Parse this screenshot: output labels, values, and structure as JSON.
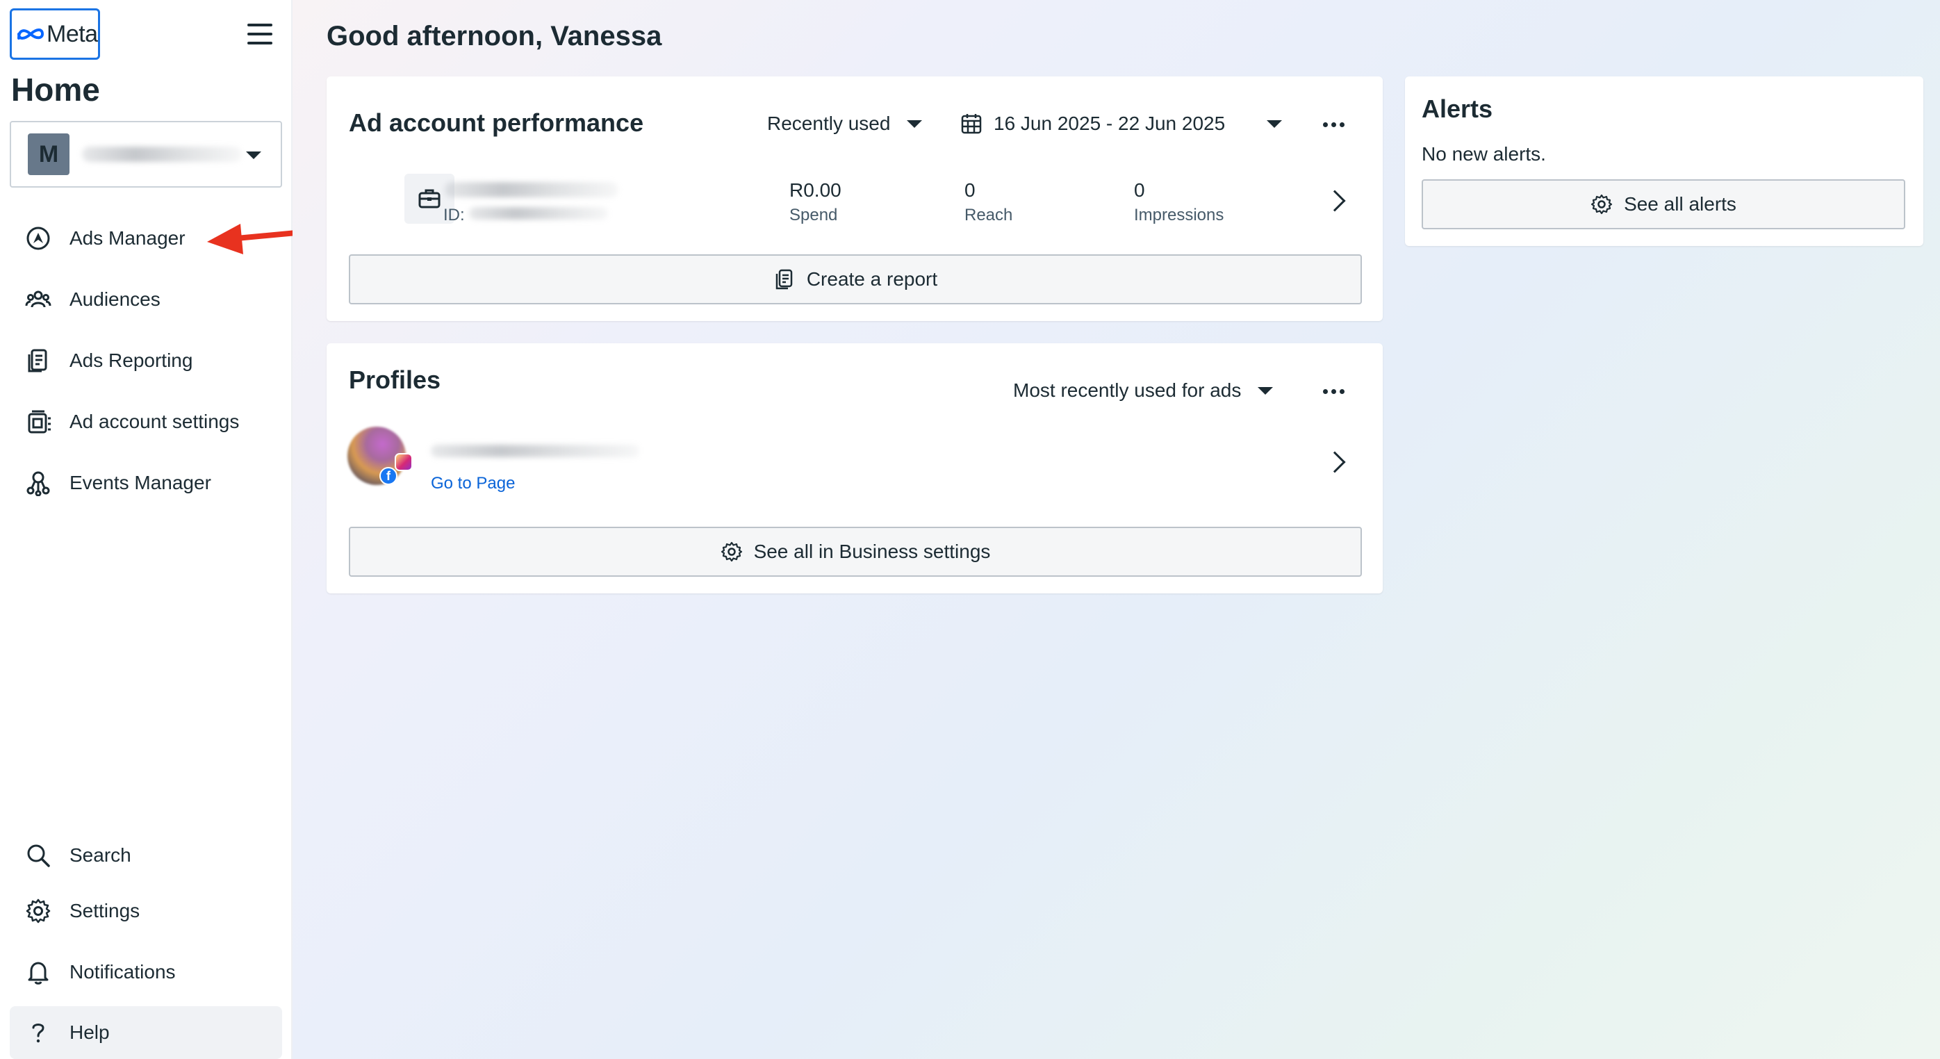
{
  "sidebar": {
    "logo_text": "Meta",
    "title": "Home",
    "account_initial": "M",
    "nav": [
      {
        "label": "Ads Manager"
      },
      {
        "label": "Audiences"
      },
      {
        "label": "Ads Reporting"
      },
      {
        "label": "Ad account settings"
      },
      {
        "label": "Events Manager"
      }
    ],
    "bottom_nav": [
      {
        "label": "Search"
      },
      {
        "label": "Settings"
      },
      {
        "label": "Notifications"
      },
      {
        "label": "Help"
      }
    ]
  },
  "main": {
    "greeting": "Good afternoon, Vanessa",
    "performance": {
      "title": "Ad account performance",
      "sort_label": "Recently used",
      "date_range": "16 Jun 2025 - 22 Jun 2025",
      "id_prefix": "ID:",
      "metrics": [
        {
          "value": "R0.00",
          "label": "Spend"
        },
        {
          "value": "0",
          "label": "Reach"
        },
        {
          "value": "0",
          "label": "Impressions"
        }
      ],
      "create_report_label": "Create a report"
    },
    "profiles": {
      "title": "Profiles",
      "sort_label": "Most recently used for ads",
      "goto_label": "Go to Page",
      "see_all_label": "See all in Business settings"
    },
    "alerts": {
      "title": "Alerts",
      "empty_text": "No new alerts.",
      "see_all_label": "See all alerts"
    }
  },
  "colors": {
    "accent": "#1b74e4",
    "link": "#0a64d8",
    "annotation_arrow": "#e8321f",
    "text": "#1c2b33"
  }
}
